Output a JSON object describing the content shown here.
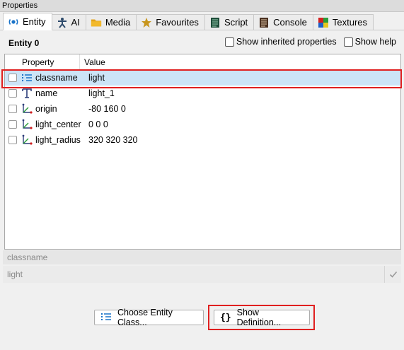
{
  "window": {
    "title": "Properties"
  },
  "tabs": [
    {
      "label": "Entity",
      "icon": "entity-icon",
      "active": true
    },
    {
      "label": "AI",
      "icon": "ai-figure-icon"
    },
    {
      "label": "Media",
      "icon": "folder-icon"
    },
    {
      "label": "Favourites",
      "icon": "star-icon"
    },
    {
      "label": "Script",
      "icon": "script-icon"
    },
    {
      "label": "Console",
      "icon": "console-icon"
    },
    {
      "label": "Textures",
      "icon": "textures-icon"
    }
  ],
  "entity": {
    "title": "Entity 0",
    "show_inherited_label": "Show inherited properties",
    "show_help_label": "Show help"
  },
  "table": {
    "columns": [
      "Property",
      "Value"
    ],
    "rows": [
      {
        "property": "classname",
        "value": "light",
        "icon": "list-icon",
        "selected": true
      },
      {
        "property": "name",
        "value": "light_1",
        "icon": "text-icon"
      },
      {
        "property": "origin",
        "value": "-80 160 0",
        "icon": "vector-axes-icon"
      },
      {
        "property": "light_center",
        "value": "0 0 0",
        "icon": "vector-axes-icon"
      },
      {
        "property": "light_radius",
        "value": "320 320 320",
        "icon": "vector-axes-icon"
      }
    ]
  },
  "editor": {
    "key": "classname",
    "value": "light"
  },
  "buttons": {
    "choose_class": "Choose Entity Class...",
    "show_definition": "Show Definition..."
  },
  "colors": {
    "highlight": "#e02020",
    "selection": "#cce4f7"
  }
}
